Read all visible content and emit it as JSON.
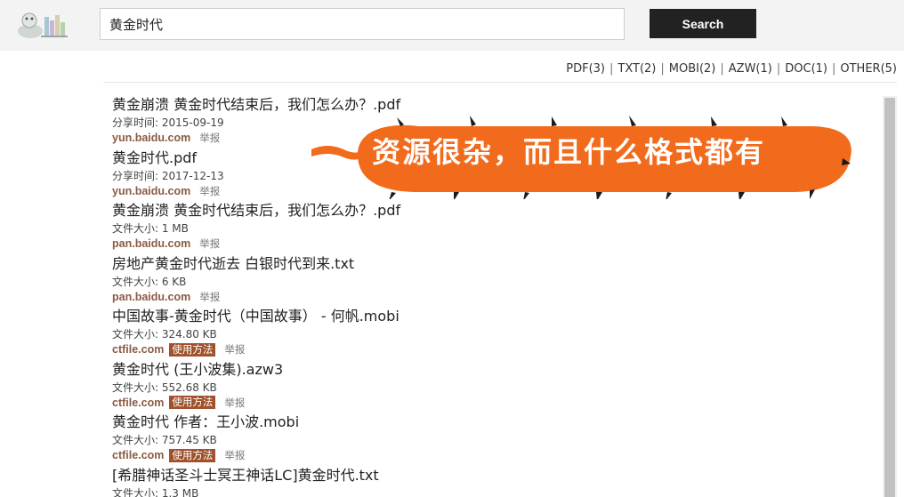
{
  "header": {
    "search_value": "黄金时代",
    "search_button": "Search"
  },
  "filters": [
    {
      "label": "PDF(3)"
    },
    {
      "label": "TXT(2)"
    },
    {
      "label": "MOBI(2)"
    },
    {
      "label": "AZW(1)"
    },
    {
      "label": "DOC(1)"
    },
    {
      "label": "OTHER(5)"
    }
  ],
  "results": [
    {
      "title": "黄金崩溃 黄金时代结束后，我们怎么办？.pdf",
      "meta": "分享时间: 2015-09-19",
      "source": "yun.baidu.com",
      "usage": "",
      "report": "举报"
    },
    {
      "title": "黄金时代.pdf",
      "meta": "分享时间: 2017-12-13",
      "source": "yun.baidu.com",
      "usage": "",
      "report": "举报"
    },
    {
      "title": "黄金崩溃 黄金时代结束后，我们怎么办？.pdf",
      "meta": "文件大小: 1 MB",
      "source": "pan.baidu.com",
      "usage": "",
      "report": "举报"
    },
    {
      "title": "房地产黄金时代逝去 白银时代到来.txt",
      "meta": "文件大小: 6 KB",
      "source": "pan.baidu.com",
      "usage": "",
      "report": "举报"
    },
    {
      "title": "中国故事-黄金时代（中国故事） - 何帆.mobi",
      "meta": "文件大小: 324.80 KB",
      "source": "ctfile.com",
      "usage": "使用方法",
      "report": "举报"
    },
    {
      "title": "黄金时代 (王小波集).azw3",
      "meta": "文件大小: 552.68 KB",
      "source": "ctfile.com",
      "usage": "使用方法",
      "report": "举报"
    },
    {
      "title": "黄金时代 作者：王小波.mobi",
      "meta": "文件大小: 757.45 KB",
      "source": "ctfile.com",
      "usage": "使用方法",
      "report": "举报"
    },
    {
      "title": "[希腊神话圣斗士冥王神话LC]黄金时代.txt",
      "meta": "文件大小: 1.3 MB",
      "source": "",
      "usage": "",
      "report": ""
    }
  ],
  "annotation": {
    "text": "资源很杂，而且什么格式都有"
  },
  "colors": {
    "annotation_bg": "#f26a1b",
    "source_link": "#8a5a44",
    "badge_bg": "#a0522d",
    "button_bg": "#222222"
  }
}
